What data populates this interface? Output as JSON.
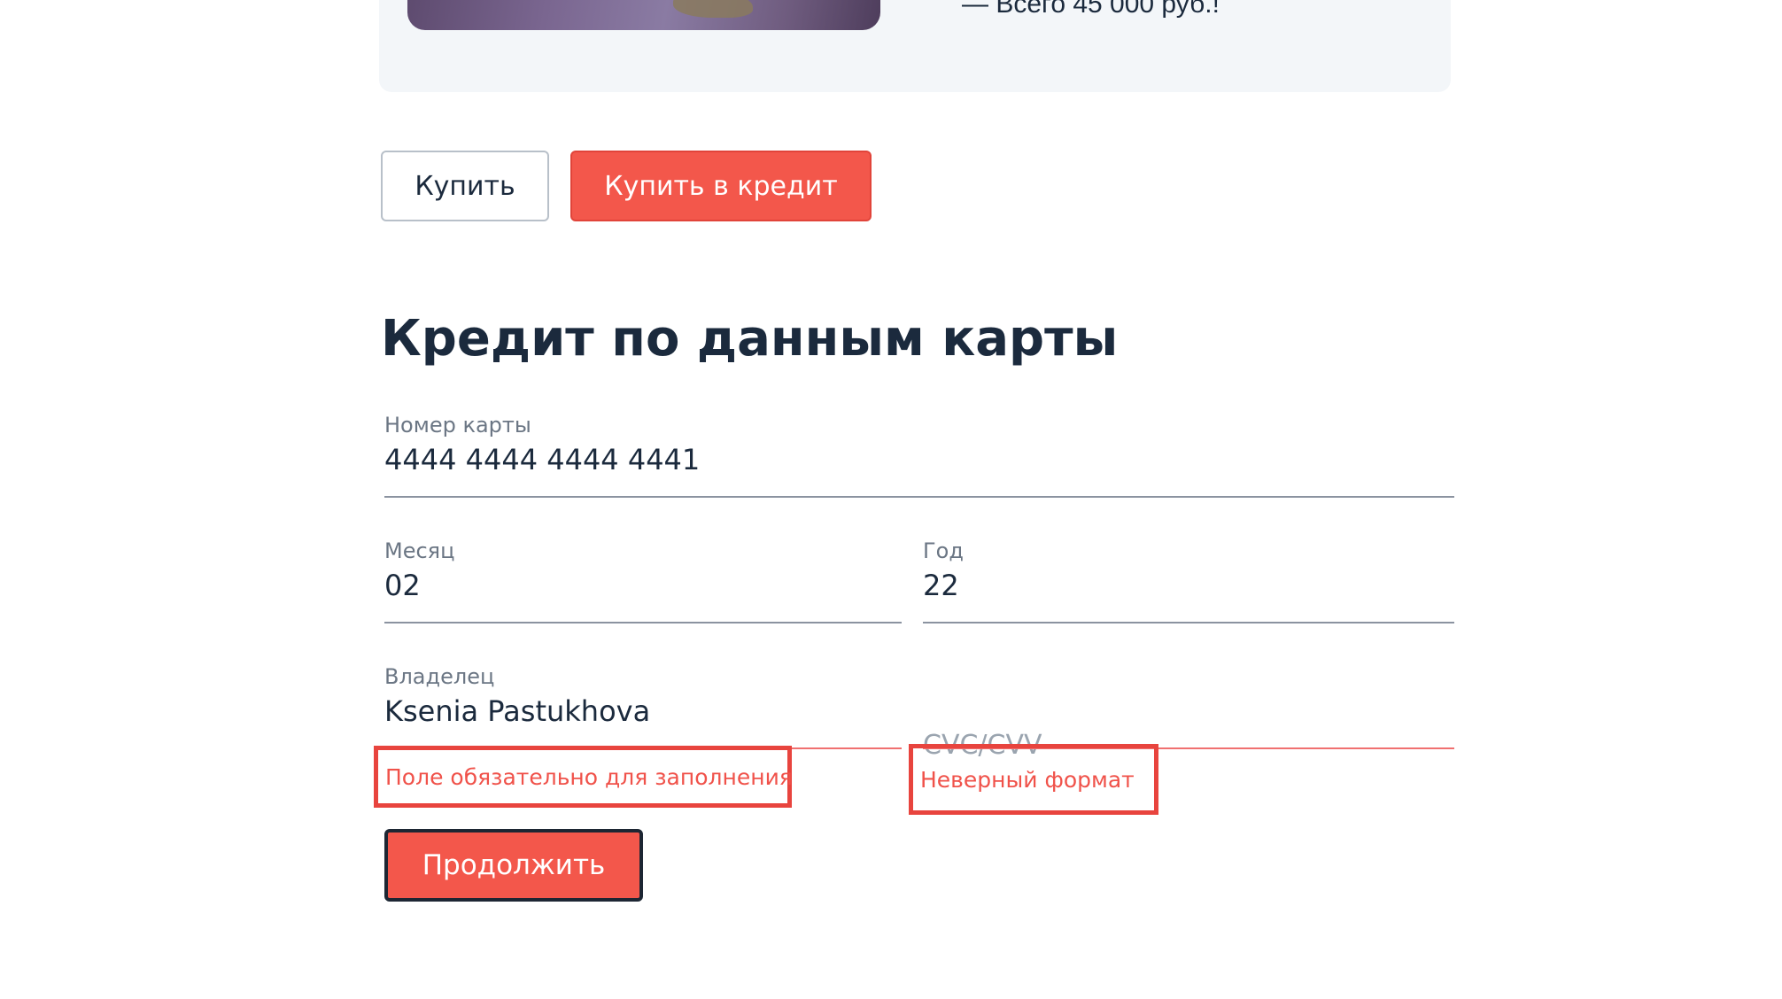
{
  "offer": {
    "price_text": "—  Всего 45 000 руб.!"
  },
  "purchase": {
    "buy_label": "Купить",
    "credit_label": "Купить в кредит"
  },
  "form": {
    "title": "Кредит по данным карты",
    "card_number": {
      "label": "Номер карты",
      "value": "4444 4444 4444 4441"
    },
    "month": {
      "label": "Месяц",
      "value": "02"
    },
    "year": {
      "label": "Год",
      "value": "22"
    },
    "owner": {
      "label": "Владелец",
      "value": "Ksenia Pastukhova",
      "error": "Поле обязательно для заполнения"
    },
    "cvc": {
      "placeholder": "CVC/CVV",
      "error": "Неверный формат"
    },
    "continue_label": "Продолжить"
  },
  "colors": {
    "accent": "#f3574b",
    "error": "#f0524a",
    "highlight_box": "#e8443e",
    "text_primary": "#1b2a3d",
    "text_secondary": "#6b7684",
    "card_background": "#f3f6f9"
  }
}
